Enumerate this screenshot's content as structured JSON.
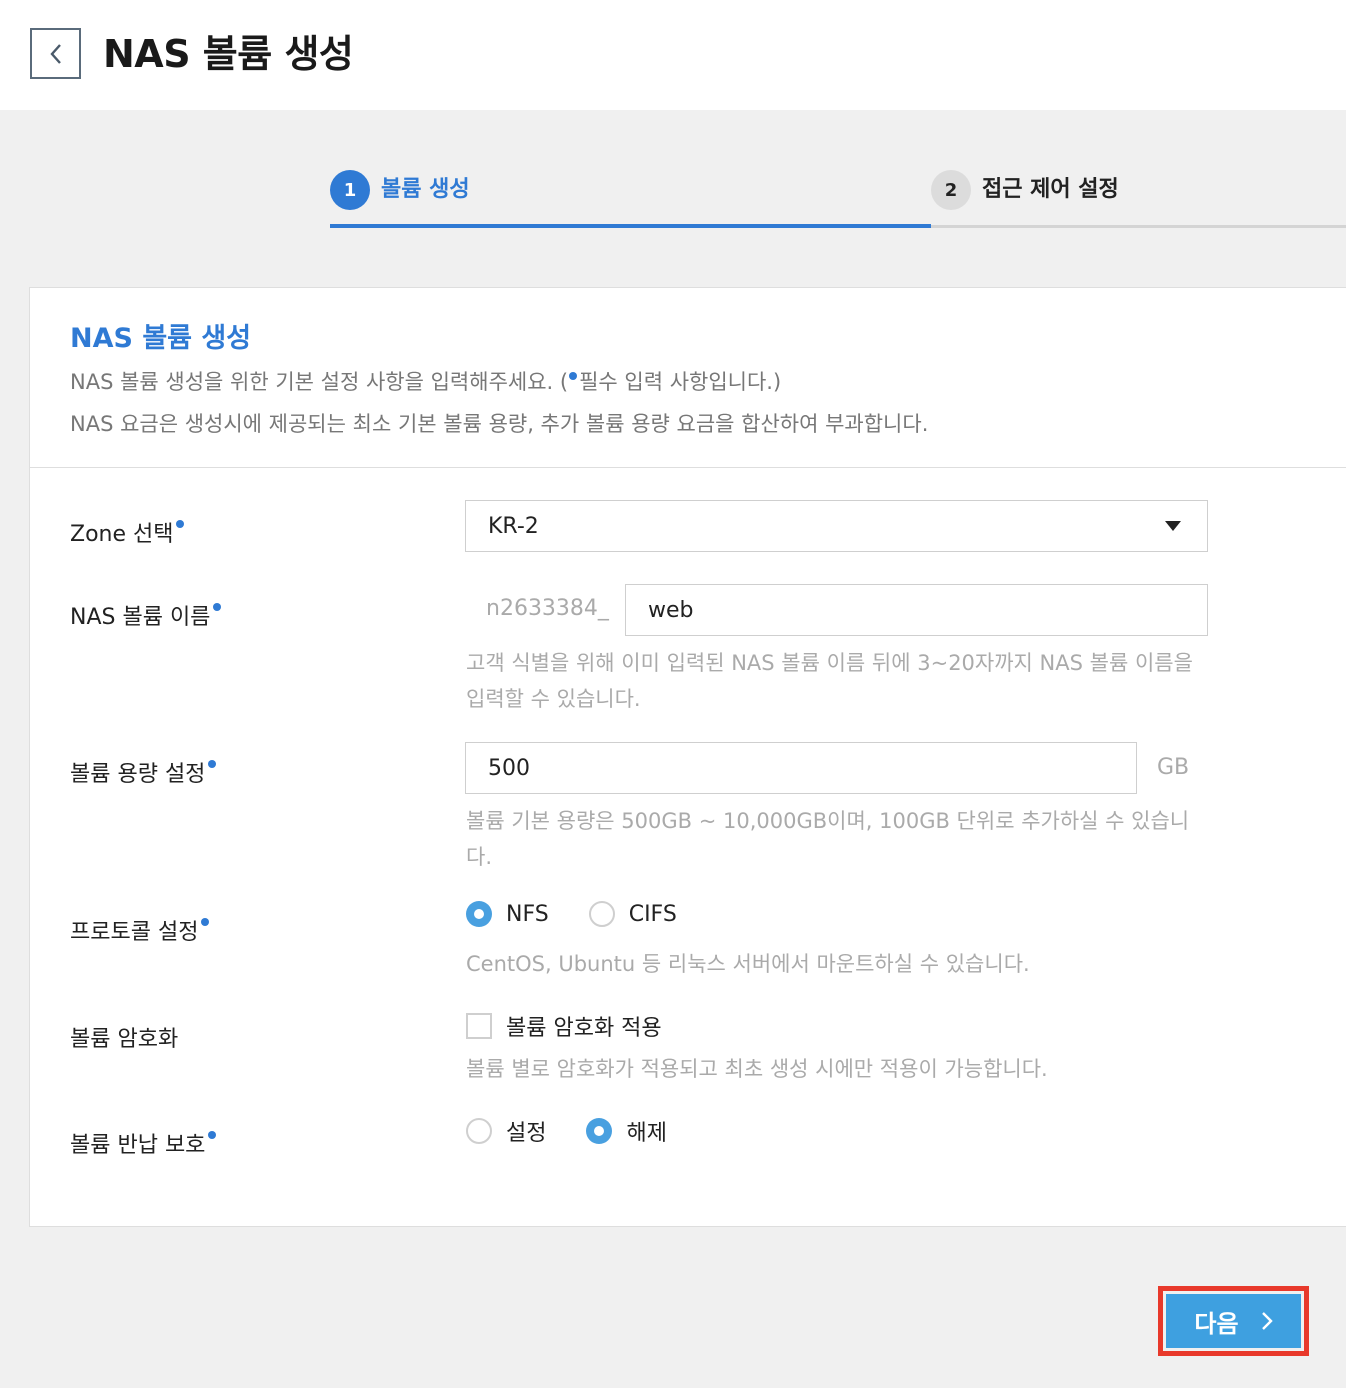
{
  "header": {
    "title": "NAS 볼륨 생성"
  },
  "stepper": [
    {
      "num": "1",
      "label": "볼륨 생성"
    },
    {
      "num": "2",
      "label": "접근 제어 설정"
    }
  ],
  "card": {
    "title": "NAS 볼륨 생성",
    "desc1_prefix": "NAS 볼륨 생성을 위한 기본 설정 사항을 입력해주세요. (",
    "desc1_suffix": "필수 입력 사항입니다.)",
    "desc2": "NAS 요금은 생성시에 제공되는 최소 기본 볼륨 용량, 추가 볼륨 용량 요금을 합산하여 부과합니다."
  },
  "form": {
    "zone": {
      "label": "Zone 선택",
      "value": "KR-2"
    },
    "name": {
      "label": "NAS 볼륨 이름",
      "prefix": "n2633384_",
      "value": "web",
      "help": "고객 식별을 위해 이미 입력된 NAS 볼륨 이름 뒤에 3~20자까지 NAS 볼륨 이름을 입력할 수 있습니다."
    },
    "capacity": {
      "label": "볼륨 용량 설정",
      "value": "500",
      "unit": "GB",
      "help": "볼륨 기본 용량은 500GB ~ 10,000GB이며, 100GB 단위로 추가하실 수 있습니다."
    },
    "protocol": {
      "label": "프로토콜 설정",
      "options": [
        "NFS",
        "CIFS"
      ],
      "selected": "NFS",
      "help": "CentOS, Ubuntu 등 리눅스 서버에서 마운트하실 수 있습니다."
    },
    "encryption": {
      "label": "볼륨 암호화",
      "checkbox_label": "볼륨 암호화 적용",
      "checked": false,
      "help": "볼륨 별로 암호화가 적용되고 최초 생성 시에만 적용이 가능합니다."
    },
    "return_protect": {
      "label": "볼륨 반납 보호",
      "options": [
        "설정",
        "해제"
      ],
      "selected": "해제"
    }
  },
  "footer": {
    "next_label": "다음"
  },
  "colors": {
    "accent": "#2f7ad4",
    "button": "#3ea0e0",
    "highlight": "#e8392b"
  }
}
